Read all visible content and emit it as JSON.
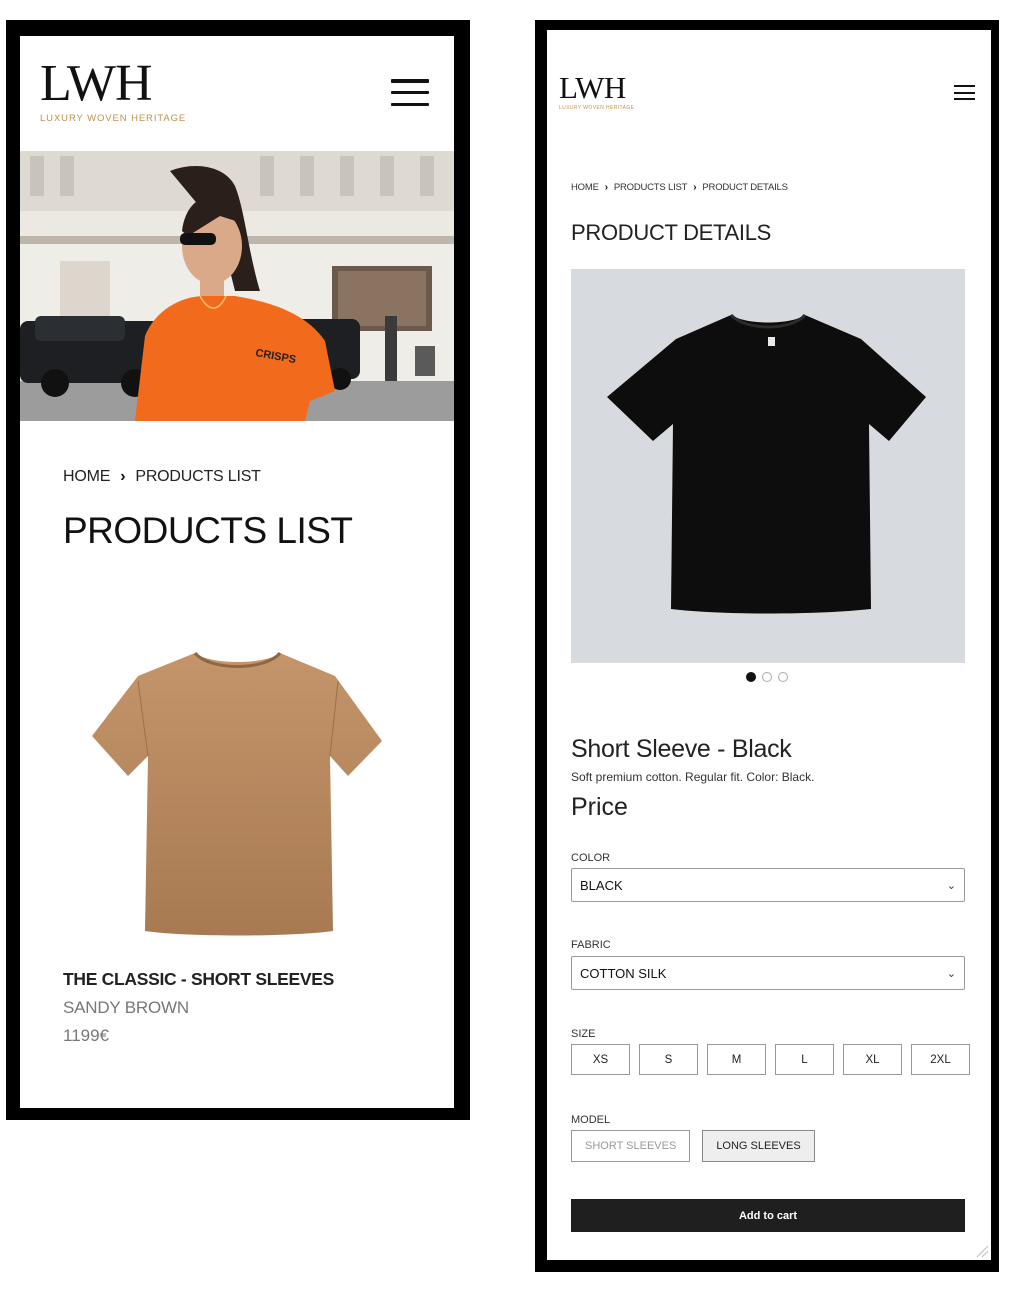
{
  "left_screen": {
    "logo": {
      "main": "LWH",
      "sub": "LUXURY WOVEN HERITAGE"
    },
    "menu_icon": "hamburger-menu-icon",
    "breadcrumb": {
      "home": "HOME",
      "current": "PRODUCTS LIST",
      "separator_icon": "chevron-right-icon"
    },
    "page_title": "PRODUCTS LIST",
    "product": {
      "name": "THE CLASSIC - SHORT SLEEVES",
      "color": "SANDY BROWN",
      "price": "1199€"
    }
  },
  "right_screen": {
    "logo": {
      "main": "LWH",
      "sub": "LUXURY WOVEN HERITAGE"
    },
    "menu_icon": "hamburger-menu-icon",
    "breadcrumb": {
      "home": "HOME",
      "list": "PRODUCTS LIST",
      "current": "PRODUCT DETAILS"
    },
    "page_title": "PRODUCT DETAILS",
    "gallery": {
      "image_count": 3,
      "active_index": 0
    },
    "product": {
      "name": "Short Sleeve - Black",
      "description": "Soft premium cotton. Regular fit. Color: Black.",
      "price_label": "Price"
    },
    "color": {
      "label": "COLOR",
      "selected": "BLACK"
    },
    "fabric": {
      "label": "FABRIC",
      "selected": "COTTON SILK"
    },
    "size": {
      "label": "SIZE",
      "options": [
        "XS",
        "S",
        "M",
        "L",
        "XL",
        "2XL"
      ]
    },
    "model": {
      "label": "MODEL",
      "options": [
        "SHORT SLEEVES",
        "LONG SLEEVES"
      ],
      "selected": "LONG SLEEVES"
    },
    "cart_button": "Add to cart"
  },
  "colors": {
    "logo_gold": "#c0914b",
    "hero_shirt": "#f26a1b",
    "product_shirt": "#b8895e",
    "gallery_bg": "#d7dbdf",
    "cart_button": "#1f1f1f"
  }
}
